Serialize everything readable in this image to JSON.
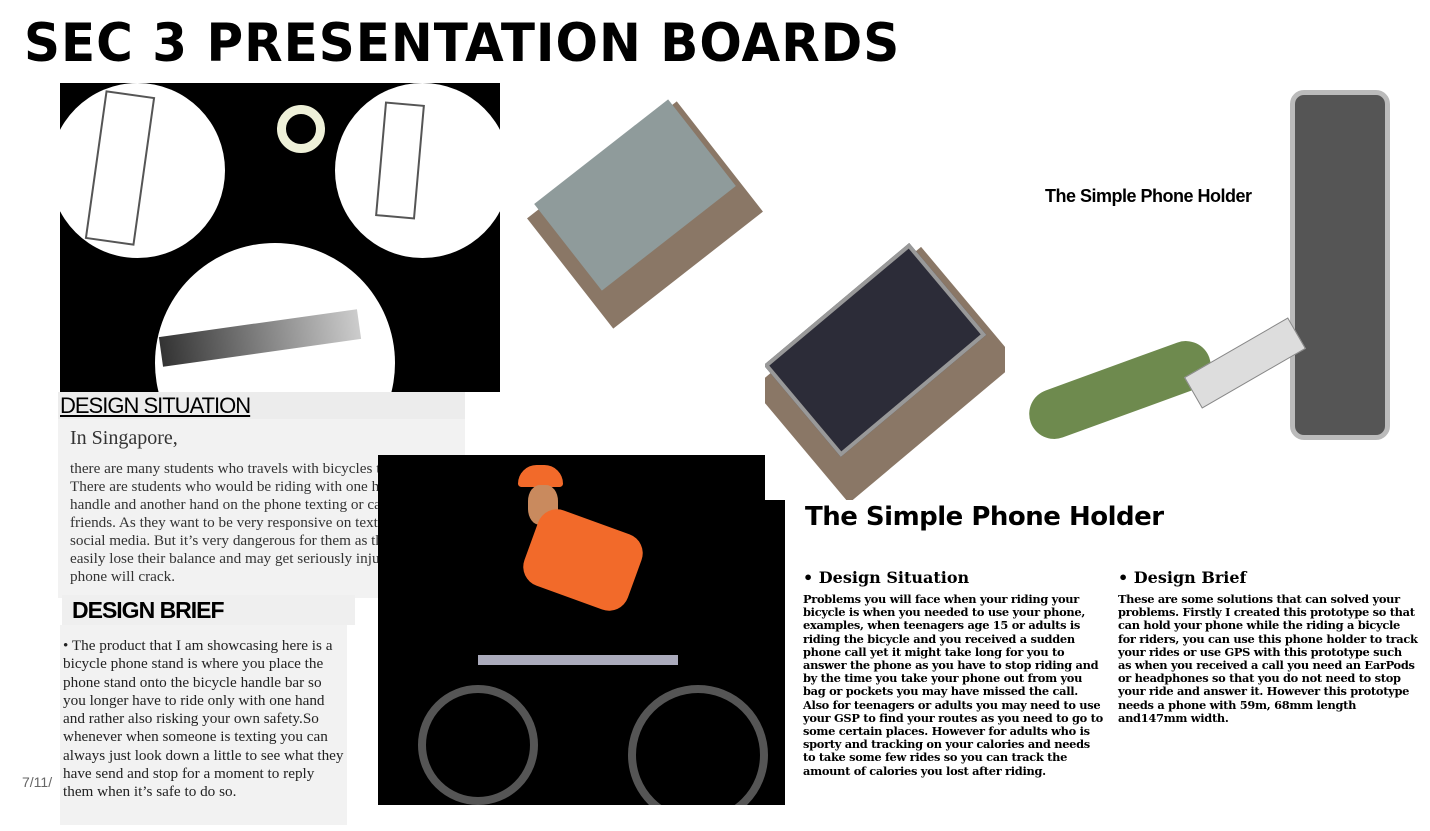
{
  "title": "SEC 3 PRESENTATION BOARDS",
  "design_situation": {
    "heading": "DESIGN SITUATION",
    "lead": "In Singapore,",
    "body": "there are many students who travels with bicycles to school.  There are students who would be riding with one hand on the handle and another hand on the phone texting or calling their friends.  As they want to be very responsive on texting and social media.  But it’s very dangerous for them as they can easily lose their balance and may get seriously injured or their phone will crack."
  },
  "design_brief": {
    "heading": "DESIGN BRIEF",
    "body": "•  The product that I am showcasing here is a bicycle phone stand is where you place the phone stand onto the bicycle handle bar so you longer have to ride only with one hand and rather also risking your own safety.So whenever when someone is texting you can always just look down a little to see what they have send and stop for a moment to reply them when it’s safe to do so."
  },
  "date_fragment": "7/11/",
  "product_label": "The Simple Phone Holder",
  "product_title": "The Simple Phone Holder",
  "columns": [
    {
      "heading": "• Design Situation",
      "body": "Problems you will face when your riding your bicycle is when you needed to use your phone, examples, when teenagers age 15 or adults is riding the bicycle and you received a sudden phone call yet it might take long for you to answer the phone as you have to stop riding and by the time you take your phone out from you bag or pockets you may have missed the call. Also for teenagers or adults you may need to use your GSP to find your routes as you need to go to some certain places. However for adults who is sporty and tracking on your calories and needs to take some few rides so you can track the amount of calories you lost after riding."
    },
    {
      "heading": "• Design Brief",
      "body": "These are some solutions that can solved your problems. Firstly I created this prototype so that can hold your phone while the riding a bicycle for riders, you can use this phone holder to track your rides or use GPS with this prototype such as when you received a call you need an EarPods or headphones so that you do not need to stop your ride and answer it. However this prototype needs a phone with 59m, 68mm length and147mm width."
    }
  ],
  "colors": {
    "holder_brown": "#8a7766",
    "holder_grey": "#8f9b9b",
    "grip_green": "#6e8a4e",
    "jersey_orange": "#f26a2a"
  }
}
